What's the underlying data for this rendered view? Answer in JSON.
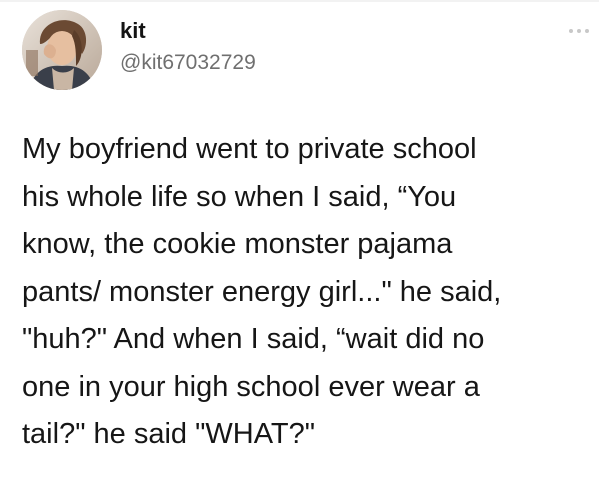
{
  "author": {
    "display_name": "kit",
    "handle": "@kit67032729",
    "avatar_icon": "profile-photo"
  },
  "menu": {
    "icon": "more-options-icon"
  },
  "tweet": {
    "lines": [
      "My boyfriend went to private school",
      "his whole life so when I said, “You",
      "know, the cookie monster pajama",
      "pants/ monster energy girl...\" he said,",
      "\"huh?\" And when I said, “wait did no",
      "one in your high school ever wear a",
      "tail?\" he said \"WHAT?\""
    ]
  },
  "colors": {
    "text": "#161616",
    "handle": "#6f6f6f",
    "background": "#ffffff"
  }
}
